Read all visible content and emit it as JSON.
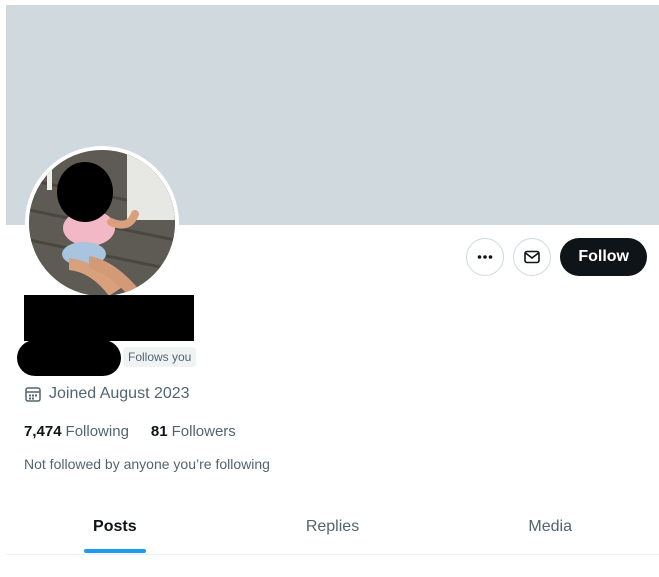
{
  "profile": {
    "follows_you_badge": "Follows you",
    "joined": "Joined August 2023",
    "following_count": "7,474",
    "following_label": "Following",
    "followers_count": "81",
    "followers_label": "Followers",
    "not_followed_text": "Not followed by anyone you’re following"
  },
  "actions": {
    "more_icon": "ellipsis-icon",
    "message_icon": "envelope-icon",
    "follow_label": "Follow"
  },
  "tabs": [
    {
      "label": "Posts",
      "active": true
    },
    {
      "label": "Replies",
      "active": false
    },
    {
      "label": "Media",
      "active": false
    }
  ],
  "colors": {
    "banner": "#cfd9de",
    "accent": "#1d9bf0",
    "follow_button": "#0f1419"
  }
}
